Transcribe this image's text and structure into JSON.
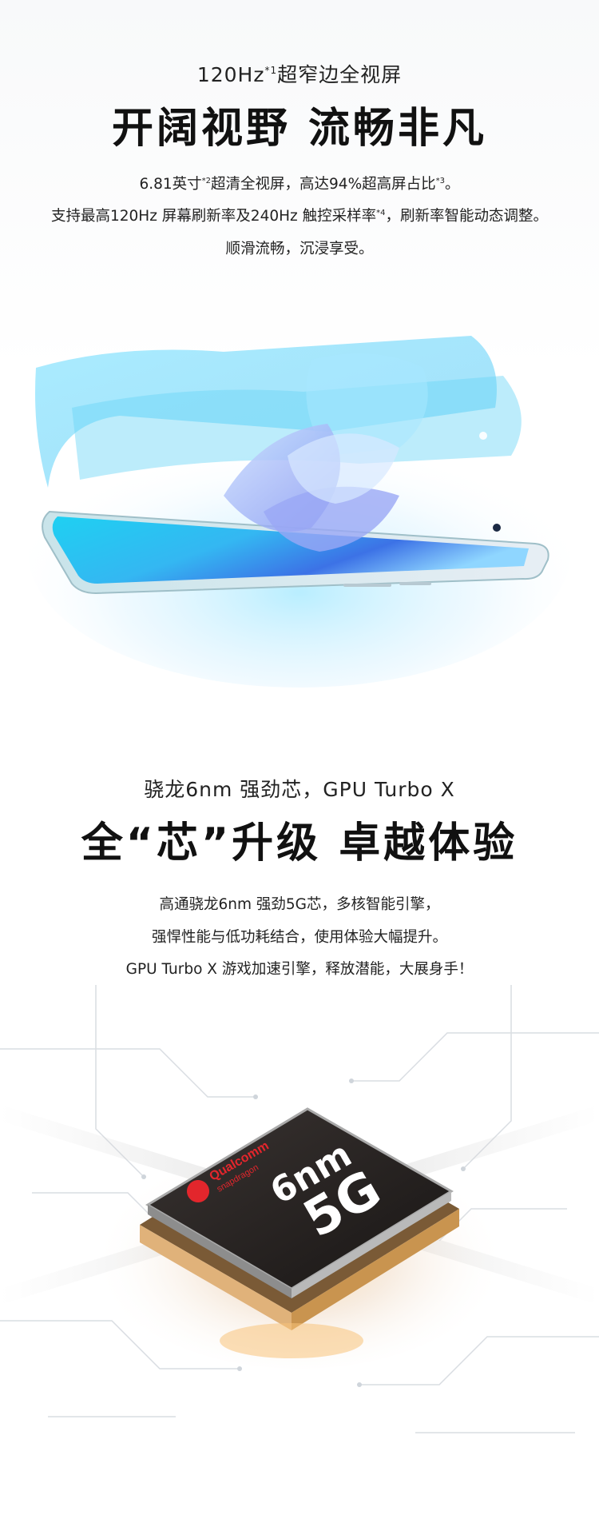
{
  "display": {
    "kicker_main": "120Hz",
    "kicker_sup": "*1",
    "kicker_rest": "超窄边全视屏",
    "headline": "开阔视野 流畅非凡",
    "line1_a": "6.81英寸",
    "line1_sup1": "*2",
    "line1_b": "超清全视屏，高达94%超高屏占比",
    "line1_sup2": "*3",
    "line1_c": "。",
    "line2_a": "支持最高120Hz 屏幕刷新率及240Hz 触控采样率",
    "line2_sup": "*4",
    "line2_b": "，刷新率智能动态调整。",
    "line3": "顺滑流畅，沉浸享受。"
  },
  "chip": {
    "kicker": "骁龙6nm 强劲芯，GPU Turbo X",
    "headline": "全“芯”升级 卓越体验",
    "line1": "高通骁龙6nm 强劲5G芯，多核智能引擎，",
    "line2": "强悍性能与低功耗结合，使用体验大幅提升。",
    "line3": "GPU Turbo X 游戏加速引擎，释放潜能，大展身手！",
    "brand_top": "Qualcomm",
    "brand_bottom": "snapdragon",
    "mark_top": "6nm",
    "mark_bottom": "5G"
  },
  "colors": {
    "screen_cyan": "#27c8ee",
    "screen_blue": "#3a6ee8",
    "chip_red": "#e3262c",
    "chip_glow": "#f3b35a"
  }
}
